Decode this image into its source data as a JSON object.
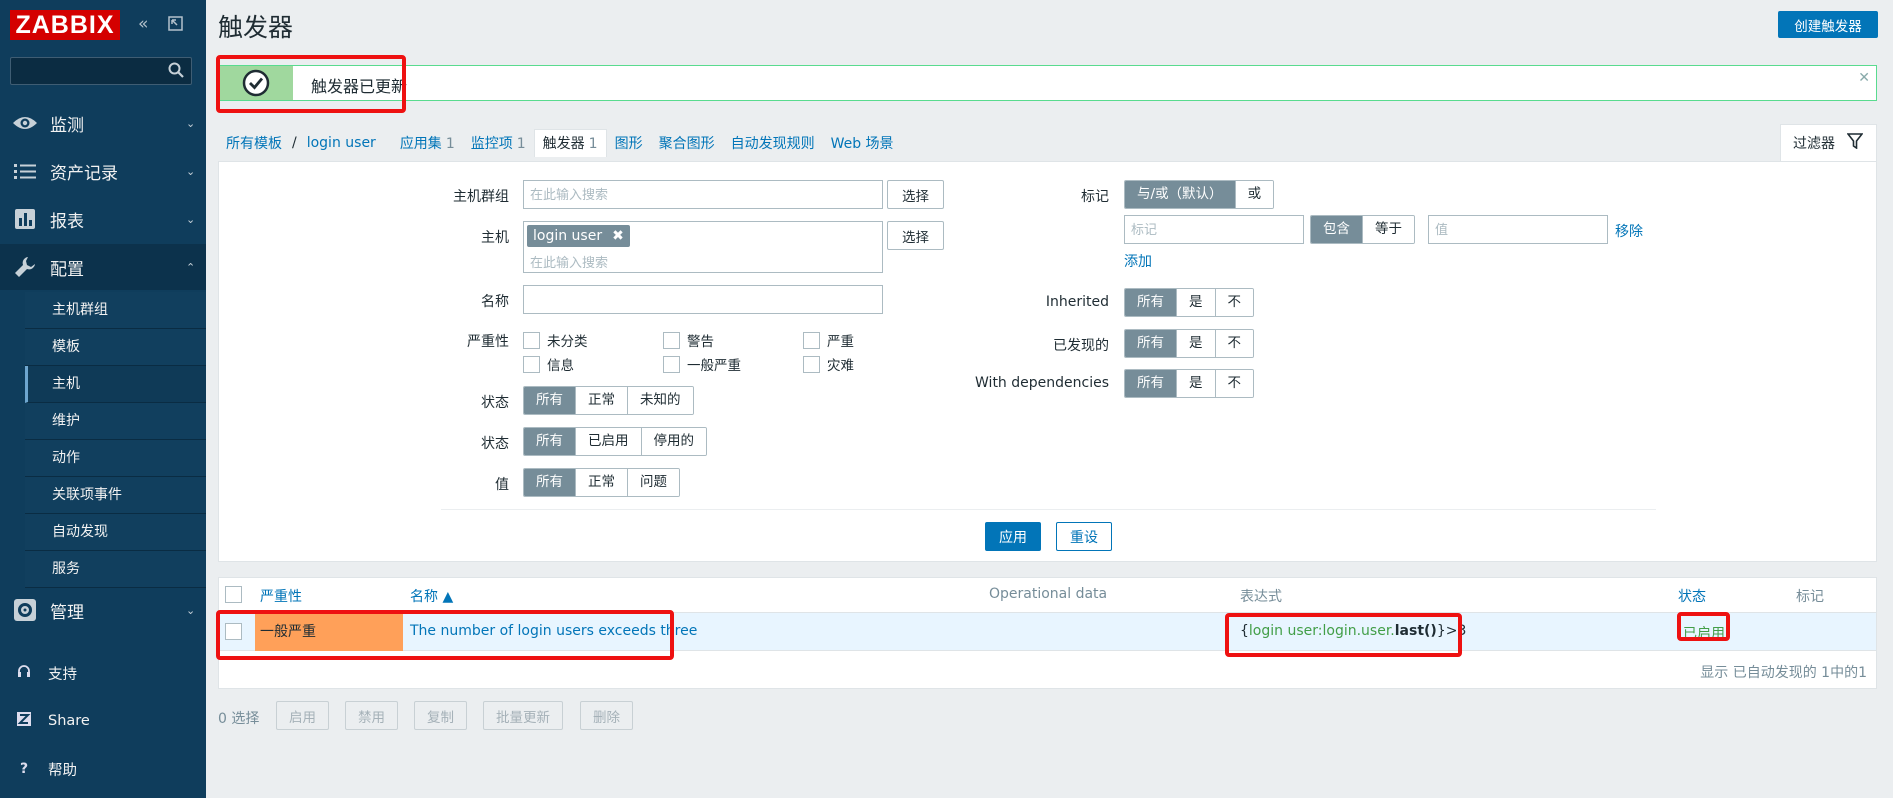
{
  "brand": {
    "logo": "ZABBIX"
  },
  "sidebar": {
    "search": {
      "value": "",
      "placeholder": ""
    },
    "sections": [
      {
        "label": "监测",
        "icon": "eye-icon"
      },
      {
        "label": "资产记录",
        "icon": "list-icon"
      },
      {
        "label": "报表",
        "icon": "bar-chart-icon"
      },
      {
        "label": "配置",
        "icon": "wrench-icon"
      },
      {
        "label": "管理",
        "icon": "gear-icon"
      }
    ],
    "config_items": [
      "主机群组",
      "模板",
      "主机",
      "维护",
      "动作",
      "关联项事件",
      "自动发现",
      "服务"
    ],
    "selected_item": "主机",
    "footer": [
      {
        "label": "支持",
        "icon": "headset-icon"
      },
      {
        "label": "Share",
        "icon": "zabbix-share-icon"
      },
      {
        "label": "帮助",
        "icon": "help-icon"
      }
    ]
  },
  "page": {
    "title": "触发器",
    "create_button": "创建触发器"
  },
  "message": {
    "text": "触发器已更新",
    "type": "success"
  },
  "tabs": {
    "all_templates": "所有模板",
    "host": "login user",
    "items": [
      {
        "label": "应用集",
        "count": "1"
      },
      {
        "label": "监控项",
        "count": "1"
      },
      {
        "label": "触发器",
        "count": "1"
      },
      {
        "label": "图形",
        "count": ""
      },
      {
        "label": "聚合图形",
        "count": ""
      },
      {
        "label": "自动发现规则",
        "count": ""
      },
      {
        "label": "Web 场景",
        "count": ""
      }
    ],
    "filter_label": "过滤器"
  },
  "filter": {
    "host_groups": {
      "label": "主机群组",
      "placeholder": "在此输入搜索",
      "select": "选择"
    },
    "hosts": {
      "label": "主机",
      "tag": "login user",
      "placeholder": "在此输入搜索",
      "select": "选择"
    },
    "name": {
      "label": "名称",
      "value": ""
    },
    "severity": {
      "label": "严重性",
      "options": [
        "未分类",
        "警告",
        "严重",
        "信息",
        "一般严重",
        "灾难"
      ]
    },
    "state": {
      "label": "状态",
      "options": [
        "所有",
        "正常",
        "未知的"
      ],
      "selected": "所有"
    },
    "status": {
      "label": "状态",
      "options": [
        "所有",
        "已启用",
        "停用的"
      ],
      "selected": "所有"
    },
    "value": {
      "label": "值",
      "options": [
        "所有",
        "正常",
        "问题"
      ],
      "selected": "所有"
    },
    "tags": {
      "label": "标记",
      "eval_options": [
        "与/或（默认）",
        "或"
      ],
      "eval_selected": "与/或（默认）",
      "tag_placeholder": "标记",
      "operator_options": [
        "包含",
        "等于"
      ],
      "operator_selected": "包含",
      "value_placeholder": "值",
      "remove": "移除",
      "add": "添加"
    },
    "inherited": {
      "label": "Inherited",
      "options": [
        "所有",
        "是",
        "不"
      ],
      "selected": "所有"
    },
    "discovered": {
      "label": "已发现的",
      "options": [
        "所有",
        "是",
        "不"
      ],
      "selected": "所有"
    },
    "with_dependencies": {
      "label": "With dependencies",
      "options": [
        "所有",
        "是",
        "不"
      ],
      "selected": "所有"
    },
    "apply": "应用",
    "reset": "重设"
  },
  "table": {
    "columns": {
      "severity": "严重性",
      "name": "名称 ▲",
      "operational_data": "Operational data",
      "expression": "表达式",
      "status": "状态",
      "tags": "标记"
    },
    "rows": [
      {
        "severity": "一般严重",
        "severity_color": "#ffa059",
        "name": "The number of login users exceeds three",
        "operational_data": "",
        "expression": {
          "open": "{",
          "host_item": "login user:login.user.",
          "func": "last()",
          "close": "}",
          "rest": ">3"
        },
        "status": "已启用",
        "tags": ""
      }
    ],
    "pager": "显示 已自动发现的 1中的1"
  },
  "actions": {
    "selected_count": "0 选择",
    "buttons": [
      "启用",
      "禁用",
      "复制",
      "批量更新",
      "删除"
    ]
  },
  "colors": {
    "sidebar_bg": "#0f3d5c",
    "primary": "#0275b8",
    "success_border": "#59db8f",
    "enabled_green": "#429e47",
    "logo_red": "#d40000",
    "highlight_red": "#ee1111"
  }
}
